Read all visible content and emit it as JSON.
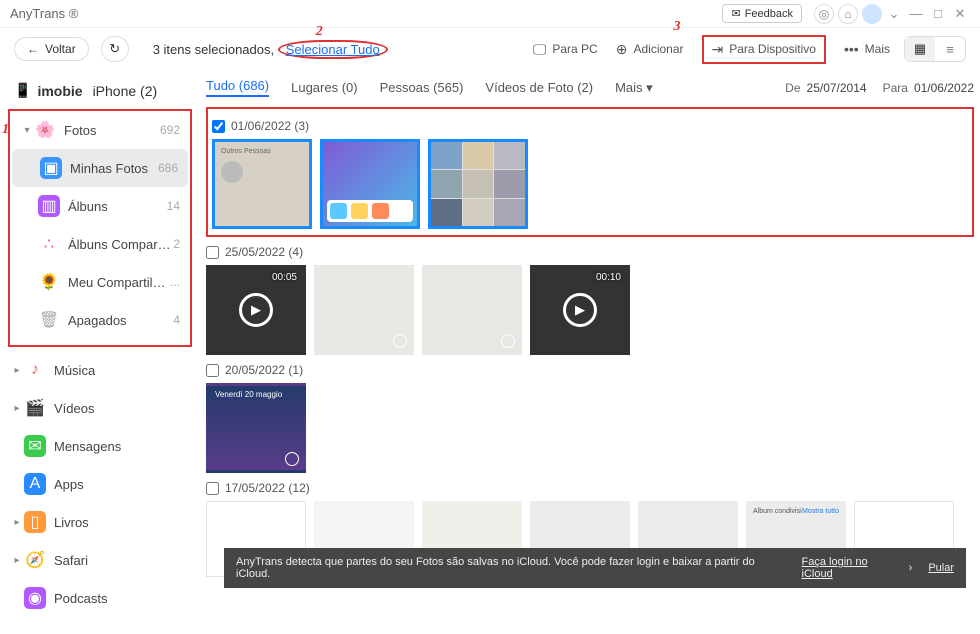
{
  "app": {
    "title": "AnyTrans ®",
    "feedback": "Feedback"
  },
  "nav": {
    "back": "Voltar"
  },
  "device": {
    "name": "imobie",
    "model": "iPhone (2)"
  },
  "selection": {
    "text": "3 itens selecionados,",
    "select_all": "Selecionar Tudo"
  },
  "actions": {
    "to_pc": "Para PC",
    "add": "Adicionar",
    "to_device": "Para Dispositivo",
    "more": "Mais"
  },
  "sidebar": {
    "photos": {
      "label": "Fotos",
      "count": "692"
    },
    "my_photos": {
      "label": "Minhas Fotos",
      "count": "686"
    },
    "albums": {
      "label": "Álbuns",
      "count": "14"
    },
    "shared_albums": {
      "label": "Álbuns Compartilhados",
      "count": "2"
    },
    "my_sharing": {
      "label": "Meu Compartilhame...",
      "count": "..."
    },
    "deleted": {
      "label": "Apagados",
      "count": "4"
    },
    "music": {
      "label": "Música"
    },
    "videos": {
      "label": "Vídeos"
    },
    "messages": {
      "label": "Mensagens"
    },
    "apps": {
      "label": "Apps"
    },
    "books": {
      "label": "Livros"
    },
    "safari": {
      "label": "Safari"
    },
    "podcasts": {
      "label": "Podcasts"
    }
  },
  "tabs": {
    "all": "Tudo (686)",
    "places": "Lugares (0)",
    "people": "Pessoas (565)",
    "photo_videos": "Vídeos de Foto (2)",
    "more": "Mais",
    "from": "De",
    "from_date": "25/07/2014",
    "to": "Para",
    "to_date": "01/06/2022"
  },
  "sections": {
    "s1": {
      "date": "01/06/2022 (3)",
      "checked": true
    },
    "s2": {
      "date": "25/05/2022 (4)",
      "t1_dur": "00:05",
      "t4_dur": "00:10"
    },
    "s3": {
      "date": "20/05/2022 (1)",
      "t1_cap": "Venerdì 20 maggio"
    },
    "s4": {
      "date": "17/05/2022 (12)"
    }
  },
  "notice": {
    "text": "AnyTrans detecta que partes do seu Fotos são salvas no iCloud. Você pode fazer login e baixar a partir do iCloud.",
    "login": "Faça login no iCloud",
    "skip": "Pular"
  },
  "annotations": {
    "a1": "1",
    "a2": "2",
    "a3": "3"
  },
  "misc": {
    "outros": "Outros Pessoas",
    "album_cond": "Album condivisi",
    "mostra": "Mostra tutto"
  }
}
